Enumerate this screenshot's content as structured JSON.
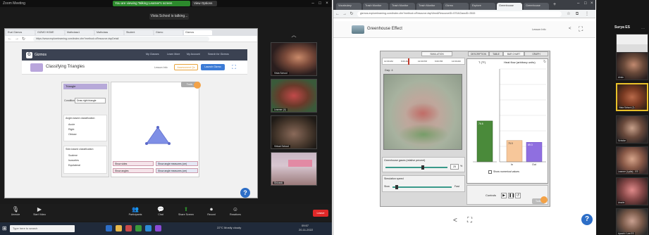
{
  "zoom": {
    "window_title": "Zoom Meeting",
    "recording_banner": "You are viewing Talking Learner's screen",
    "view_options_label": "View Options",
    "talking_label": "Vista School is talking...",
    "browser_tabs": [
      "Eval Gizmos",
      "GIZMO HOME",
      "Mathclass1",
      "Mathclass",
      "Student",
      "Gizmo",
      "Gizmos"
    ],
    "browser_url": "https://www.explorelearning.com/index.cfm?method=cResource.dspDetail",
    "gizmos_app_name": "Gizmos",
    "gizmos_nav": [
      "My Classes",
      "Learn More",
      "My Account",
      "Search for Gizmos"
    ],
    "gizmo_title": "Classifying Triangles",
    "gizmo_lesson": "Lesson Info",
    "gizmo_btn_assessment": "Assessment Qs",
    "gizmo_btn_launch": "Launch Gizmo",
    "gizmo_panel": {
      "header": "Triangle",
      "condition_label": "Condition",
      "condition_value": "Draw right triangle",
      "angle_heading": "Angle-based classification",
      "angle_options": [
        "Acute",
        "Right",
        "Obtuse"
      ],
      "side_heading": "Side-based classification",
      "side_options": [
        "Scalene",
        "Isosceles",
        "Equilateral"
      ]
    },
    "canvas_tools_label": "Tools",
    "canvas_checkboxes": [
      "Show sides",
      "Show angle measures (cm)",
      "Show angles",
      "Show angle measures (cm)"
    ],
    "participants": [
      {
        "label": "Vista School"
      },
      {
        "label": "Learner (4)"
      },
      {
        "label": "Virtual School"
      },
      {
        "label": "Shivank"
      }
    ],
    "toolbar": [
      {
        "icon": "mic-icon",
        "label": "Unmute"
      },
      {
        "icon": "video-icon",
        "label": "Start Video"
      },
      {
        "icon": "participants-icon",
        "label": "Participants"
      },
      {
        "icon": "chat-icon",
        "label": "Chat"
      },
      {
        "icon": "share-screen-icon",
        "label": "Share Screen"
      },
      {
        "icon": "record-icon",
        "label": "Record"
      },
      {
        "icon": "reactions-icon",
        "label": "Reactions"
      }
    ],
    "end_label": "Leave",
    "taskbar_search": "Type here to search",
    "taskbar_weather": "22°C Mostly cloudy",
    "taskbar_time": "09:57",
    "taskbar_date": "20-11-2022"
  },
  "greenhouse": {
    "tabs": [
      "Vocabulary",
      "Trash Monitor",
      "Trash Monitor",
      "Trash Monitor",
      "Gizmo",
      "Explore",
      "Greenhouse",
      "Greenhouse"
    ],
    "url": "gizmos.explorelearning.com/index.cfm?method=cResource.dspView&ResourceID=570&ClassID=3515",
    "title": "Greenhouse Effect",
    "lesson_info": "Lesson Info",
    "sim_tabs": [
      "SIMULATION",
      "DESCRIPTION",
      "TABLE",
      "BAR CHART",
      "GRAPH"
    ],
    "timeline": [
      "12:00 AM",
      "6:00 AM",
      "12:00 PM",
      "6:00 PM",
      "12:00 AM"
    ],
    "day_label": "Day: 4",
    "chart_temp_label": "T (°F)",
    "chart_heat_label": "Heat flow (arbitrary units)",
    "temp_value": "76.6",
    "heat_in_value": "75.9",
    "heat_out_value": "69.3",
    "bar_in_label": "In",
    "bar_out_label": "Out",
    "show_numerical": "Show numerical values",
    "gas_label": "Greenhouse gases (relative percent)",
    "gas_value": "25",
    "gas_unit": "%",
    "speed_label": "Simulation speed",
    "speed_slow": "Slow",
    "speed_fast": "Fast",
    "controls_label": "Controls",
    "tools_label": "Tools",
    "temp_level": 0.44,
    "heat_in_level": 0.23,
    "heat_out_level": 0.21,
    "gas_level": 0.6,
    "speed_level": 0.07
  },
  "strip": {
    "name": "Surya ES",
    "participants": [
      {
        "label": "Sanya ES"
      },
      {
        "label": "Aimin"
      },
      {
        "label": "Vista School (2)"
      },
      {
        "label": "Scholar"
      },
      {
        "label": "Learner (Lydia) - ES"
      },
      {
        "label": "Aswini"
      },
      {
        "label": "Lily"
      },
      {
        "label": "Ayushi / Lee ES"
      }
    ]
  },
  "colors": {
    "zoom_green": "#2c8a2c",
    "gizmo_blue": "#3c7bd6",
    "gizmo_orange": "#f3a247",
    "bar_temp": "#4a8a3a",
    "bar_in": "#f7c79a",
    "bar_out": "#8f6fe0",
    "triangle": "#7f8fe6",
    "end_red": "#e02828"
  }
}
